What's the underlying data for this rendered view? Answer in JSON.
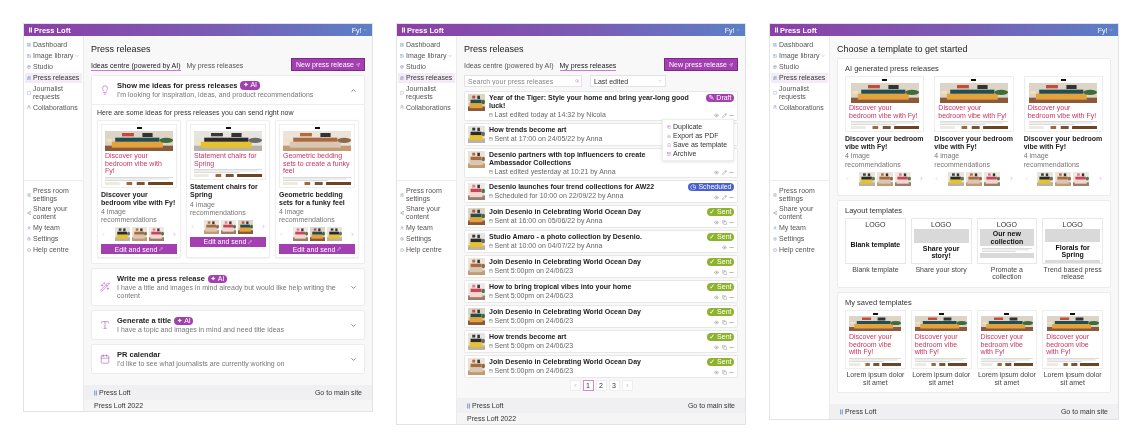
{
  "screens": [
    {
      "kind": "ideas",
      "header": {
        "brand": "Press Loft",
        "user": "Fy!"
      },
      "sidebar": {
        "main": [
          {
            "label": "Dashboard",
            "kind": "link",
            "selected": false
          },
          {
            "label": "Image library",
            "kind": "group",
            "selected": false
          },
          {
            "label": "Studio",
            "kind": "link",
            "selected": false
          },
          {
            "label": "Press releases",
            "kind": "link",
            "selected": true
          },
          {
            "label": "Journalist requests",
            "kind": "link",
            "selected": false
          },
          {
            "label": "Collaborations",
            "kind": "link",
            "selected": false
          }
        ],
        "bottom": [
          {
            "label": "Press room settings",
            "selected": false
          },
          {
            "label": "Share your content",
            "selected": false
          },
          {
            "label": "My team",
            "selected": false
          },
          {
            "label": "Settings",
            "selected": false
          },
          {
            "label": "Help centre",
            "selected": false
          }
        ]
      },
      "title": "Press releases",
      "tabs": [
        {
          "label": "Ideas centre (powered by AI)",
          "selected": true
        },
        {
          "label": "My press releases",
          "selected": false
        }
      ],
      "new_button": "New press release",
      "accordions": [
        {
          "title": "Show me ideas for press releases",
          "badge": "✦ AI",
          "subtitle": "I'm looking for inspiration, ideas, and product recommendations",
          "expanded": true,
          "intro": "Here are some ideas for press releases you can send right now",
          "cards": [
            {
              "preview_title": "Discover your bedroom vibe with Fy!",
              "title": "Discover your bedroom vibe with Fy!",
              "subtitle": "4 image recommendations",
              "button": "Edit and send"
            },
            {
              "preview_title": "Statement chairs for Spring",
              "title": "Statement chairs for Spring",
              "subtitle": "4 image recommendations",
              "button": "Edit and send"
            },
            {
              "preview_title": "Geometric bedding sets to create a funky feel",
              "title": "Geometric bedding sets for a funky feel",
              "subtitle": "4 image recommendations",
              "button": "Edit and send"
            }
          ]
        },
        {
          "title": "Write me a press release",
          "badge": "✦ AI",
          "subtitle": "I have a title and images in mind already but would like help writing the content",
          "expanded": false
        },
        {
          "title": "Generate a title",
          "badge": "✦ AI",
          "subtitle": "I have a topic and images in mind and need title ideas",
          "expanded": false
        },
        {
          "title": "PR calendar",
          "subtitle": "I'd like to see what journalists are currently working on",
          "expanded": false
        }
      ],
      "footer": {
        "brand": "Press Loft",
        "link": "Go to main site",
        "copyright": "Press Loft 2022"
      }
    },
    {
      "kind": "list",
      "header": {
        "brand": "Press Loft",
        "user": "Fy!"
      },
      "sidebar": {
        "main": [
          {
            "label": "Dashboard",
            "kind": "link",
            "selected": false
          },
          {
            "label": "Image library",
            "kind": "group",
            "selected": false
          },
          {
            "label": "Studio",
            "kind": "link",
            "selected": false
          },
          {
            "label": "Press releases",
            "kind": "link",
            "selected": true
          },
          {
            "label": "Journalist requests",
            "kind": "link",
            "selected": false
          },
          {
            "label": "Collaborations",
            "kind": "link",
            "selected": false
          }
        ],
        "bottom": [
          {
            "label": "Press room settings",
            "selected": false
          },
          {
            "label": "Share your content",
            "selected": false
          },
          {
            "label": "My team",
            "selected": false
          },
          {
            "label": "Settings",
            "selected": false
          },
          {
            "label": "Help centre",
            "selected": false
          }
        ]
      },
      "title": "Press releases",
      "tabs": [
        {
          "label": "Ideas centre (powered by AI)",
          "selected": false
        },
        {
          "label": "My press releases",
          "selected": true
        }
      ],
      "new_button": "New press release",
      "search": {
        "placeholder": "Search your press releases"
      },
      "sort": {
        "value": "Last edited"
      },
      "rows": [
        {
          "title": "Year of the Tiger: Style your home and bring year-long good luck!",
          "meta": "Last edited today at 14:32 by Nicola",
          "status": {
            "kind": "draft",
            "label": "✎ Draft"
          },
          "actions": [
            {
              "kind": "view"
            },
            {
              "kind": "edit"
            },
            {
              "kind": "more"
            }
          ],
          "menu": [
            "Duplicate",
            "Export as PDF",
            "Save as template",
            "Archive"
          ]
        },
        {
          "title": "How trends become art",
          "meta": "Sent at 17:00 on 24/05/22 by Anna",
          "actions": []
        },
        {
          "title": "Desenio partners with top influencers to create Ambassador Collections",
          "meta": "Last edited yesterday at 10:21 by Anna",
          "actions": [
            {
              "kind": "view"
            },
            {
              "kind": "edit"
            },
            {
              "kind": "more"
            }
          ]
        },
        {
          "title": "Desenio launches four trend collections for AW22",
          "meta": "Scheduled for 10:00 on 22/09/22 by Anna",
          "status": {
            "kind": "scheduled",
            "label": "◷ Scheduled"
          },
          "actions": [
            {
              "kind": "view"
            },
            {
              "kind": "edit"
            },
            {
              "kind": "more"
            }
          ]
        },
        {
          "title": "Join Desenio in Celebrating World Ocean Day",
          "meta": "Sent at 16:00 on 05/06/22 by Anna",
          "status": {
            "kind": "sent",
            "label": "✓ Sent"
          },
          "actions": [
            {
              "kind": "view"
            },
            {
              "kind": "copy"
            },
            {
              "kind": "more"
            }
          ]
        },
        {
          "title": "Studio Amaro - a photo collection by Desenio.",
          "meta": "Sent at 10:00 on 04/07/22 by Anna",
          "status": {
            "kind": "sent",
            "label": "✓ Sent"
          },
          "actions": [
            {
              "kind": "view"
            },
            {
              "kind": "more"
            }
          ]
        },
        {
          "title": "Join Desenio in Celebrating World Ocean Day",
          "meta": "Sent 5:00pm on 24/06/23",
          "status": {
            "kind": "sent",
            "label": "✓ Sent"
          },
          "actions": [
            {
              "kind": "view"
            },
            {
              "kind": "copy"
            },
            {
              "kind": "more"
            }
          ]
        },
        {
          "title": "How to bring tropical vibes into your home",
          "meta": "Sent 5:00pm on 24/06/23",
          "status": {
            "kind": "sent",
            "label": "✓ Sent"
          },
          "actions": [
            {
              "kind": "view"
            },
            {
              "kind": "copy"
            },
            {
              "kind": "more"
            }
          ]
        },
        {
          "title": "Join Desenio in Celebrating World Ocean Day",
          "meta": "Sent 5:00pm on 24/06/23",
          "status": {
            "kind": "sent",
            "label": "✓ Sent"
          },
          "actions": [
            {
              "kind": "view"
            },
            {
              "kind": "copy"
            },
            {
              "kind": "more"
            }
          ]
        },
        {
          "title": "How trends become art",
          "meta": "Sent 5:00pm on 24/06/23",
          "status": {
            "kind": "sent",
            "label": "✓ Sent"
          },
          "actions": [
            {
              "kind": "view"
            },
            {
              "kind": "copy"
            },
            {
              "kind": "more"
            }
          ]
        },
        {
          "title": "Join Desenio in Celebrating World Ocean Day",
          "meta": "Sent 5:00pm on 24/06/23",
          "status": {
            "kind": "sent",
            "label": "✓ Sent"
          },
          "actions": [
            {
              "kind": "view"
            },
            {
              "kind": "copy"
            },
            {
              "kind": "more"
            }
          ]
        }
      ],
      "pages": [
        {
          "label": "1",
          "selected": true
        },
        {
          "label": "2",
          "selected": false
        },
        {
          "label": "3",
          "selected": false
        }
      ],
      "footer": {
        "brand": "Press Loft",
        "link": "Go to main site",
        "copyright": "Press Loft 2022"
      }
    },
    {
      "kind": "templates",
      "header": {
        "brand": "Press Loft",
        "user": "Fy!"
      },
      "sidebar": {
        "main": [
          {
            "label": "Dashboard",
            "kind": "link",
            "selected": false
          },
          {
            "label": "Image library",
            "kind": "group",
            "selected": false
          },
          {
            "label": "Studio",
            "kind": "link",
            "selected": false
          },
          {
            "label": "Press releases",
            "kind": "link",
            "selected": true
          },
          {
            "label": "Journalist requests",
            "kind": "link",
            "selected": false
          },
          {
            "label": "Collaborations",
            "kind": "link",
            "selected": false
          }
        ],
        "bottom": [
          {
            "label": "Press room settings",
            "selected": false
          },
          {
            "label": "Share your content",
            "selected": false
          },
          {
            "label": "My team",
            "selected": false
          },
          {
            "label": "Settings",
            "selected": false
          },
          {
            "label": "Help centre",
            "selected": false
          }
        ]
      },
      "title": "Choose a template to get started",
      "sections": [
        {
          "kind": "ai",
          "title": "AI generated press releases",
          "cards": [
            {
              "preview_title": "Discover your bedroom vibe with Fy!",
              "title": "Discover your bedroom vibe with Fy!",
              "subtitle": "4 image recommendations"
            },
            {
              "preview_title": "Discover your bedroom vibe with Fy!",
              "title": "Discover your bedroom vibe with Fy!",
              "subtitle": "4 image recommendations"
            },
            {
              "preview_title": "Discover your bedroom vibe with Fy!",
              "title": "Discover your bedroom vibe with Fy!",
              "subtitle": "4 image recommendations"
            }
          ]
        },
        {
          "kind": "layout",
          "title": "Layout templates",
          "cards": [
            {
              "preview": {
                "kind": "blank",
                "logo": "LOGO",
                "heading": "Blank template"
              },
              "caption": "Blank template"
            },
            {
              "preview": {
                "kind": "story",
                "logo": "LOGO",
                "heading": "Share your story!"
              },
              "caption": "Share your story"
            },
            {
              "preview": {
                "kind": "collection",
                "logo": "LOGO",
                "heading": "Our new collection"
              },
              "caption": "Promote a collection"
            },
            {
              "preview": {
                "kind": "trend",
                "logo": "LOGO",
                "heading": "Florals for Spring"
              },
              "caption": "Trend based press release"
            }
          ]
        },
        {
          "kind": "saved",
          "title": "My saved templates",
          "cards": [
            {
              "preview_title": "Discover your bedroom vibe with Fy!",
              "caption": "Lorem ipsum dolor sit amet"
            },
            {
              "preview_title": "Discover your bedroom vibe with Fy!",
              "caption": "Lorem ipsum dolor sit amet"
            },
            {
              "preview_title": "Discover your bedroom vibe with Fy!",
              "caption": "Lorem ipsum dolor sit amet"
            },
            {
              "preview_title": "Discover your bedroom vibe with Fy!",
              "caption": "Lorem ipsum dolor sit amet"
            }
          ]
        }
      ],
      "footer": {
        "brand": "Press Loft",
        "link": "Go to main site"
      }
    }
  ]
}
